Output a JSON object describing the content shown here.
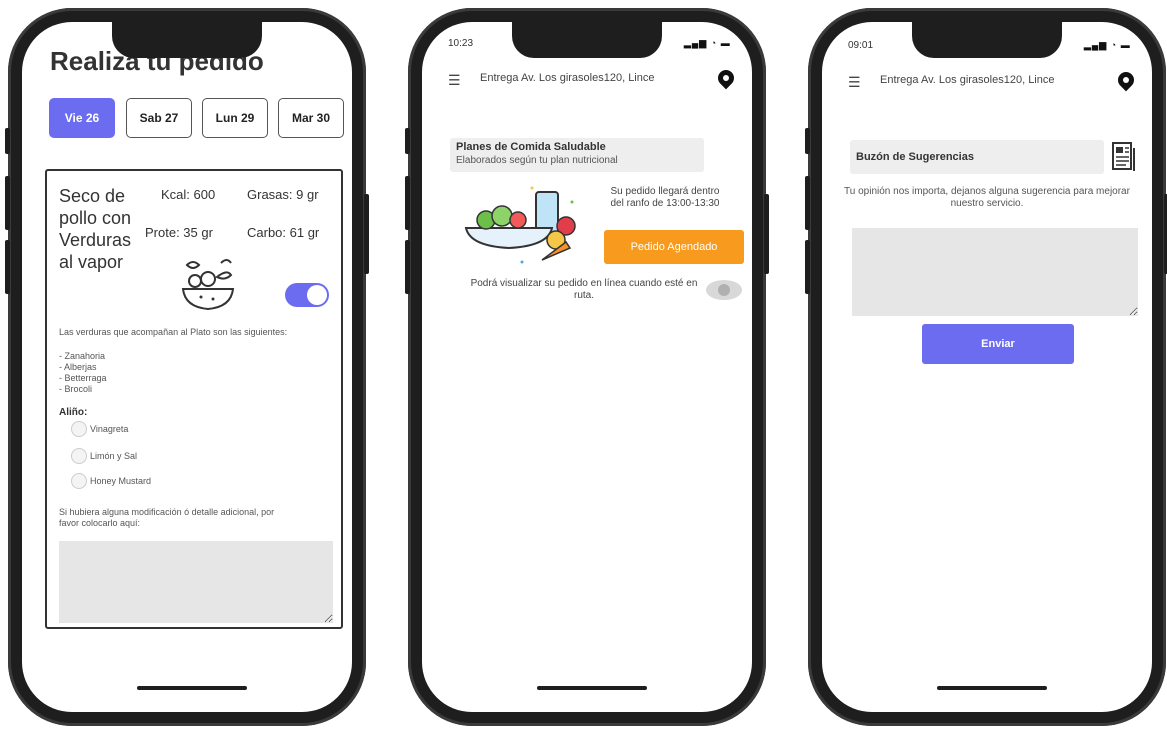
{
  "screen1": {
    "title": "Realiza tu pedido",
    "dates": [
      {
        "label": "Vie 26",
        "active": true
      },
      {
        "label": "Sab 27",
        "active": false
      },
      {
        "label": "Lun 29",
        "active": false
      },
      {
        "label": "Mar 30",
        "active": false
      }
    ],
    "dish": {
      "name": "Seco de pollo con Verduras al vapor",
      "kcal": "Kcal: 600",
      "grasas": "Grasas: 9 gr",
      "prote": "Prote: 35 gr",
      "carbo": "Carbo: 61 gr",
      "toggle_on": true,
      "description": "Las verduras que acompañan al Plato son las siguientes:",
      "vegetables": [
        "- Zanahoria",
        "- Alberjas",
        "- Betterraga",
        "- Brocoli"
      ],
      "dressing_label": "Aliño:",
      "dressing_options": [
        "Vinagreta",
        "Limón y Sal",
        "Honey Mustard"
      ],
      "notes_prompt": "Si hubiera alguna modificación ó detalle adicional, por favor colocarlo aquí:",
      "notes_value": ""
    }
  },
  "screen2": {
    "time": "10:23",
    "address": "Entrega Av. Los girasoles120, Lince",
    "plan_title": "Planes de Comida Saludable",
    "plan_subtitle": "Elaborados según tu plan nutricional",
    "eta_text": "Su pedido llegará dentro del ranfo de 13:00-13:30",
    "scheduled_button": "Pedido Agendado",
    "tracking_text": "Podrá visualizar su pedido en línea cuando esté en ruta."
  },
  "screen3": {
    "time": "09:01",
    "address": "Entrega Av. Los girasoles120, Lince",
    "suggestion_title": "Buzón de Sugerencias",
    "suggestion_message": "Tu opinión nos importa, dejanos alguna sugerencia para mejorar nuestro servicio.",
    "suggestion_value": "",
    "send_button": "Enviar"
  },
  "colors": {
    "accent": "#6c6cf0",
    "orange": "#f79a1d",
    "frame": "#1e1e1e",
    "field": "#e6e6e6"
  },
  "icons": [
    "hamburger-icon",
    "location-pin-icon",
    "salad-bowl-icon",
    "food-illustration",
    "eye-icon",
    "document-icon",
    "signal-icon",
    "wifi-icon",
    "battery-icon"
  ]
}
